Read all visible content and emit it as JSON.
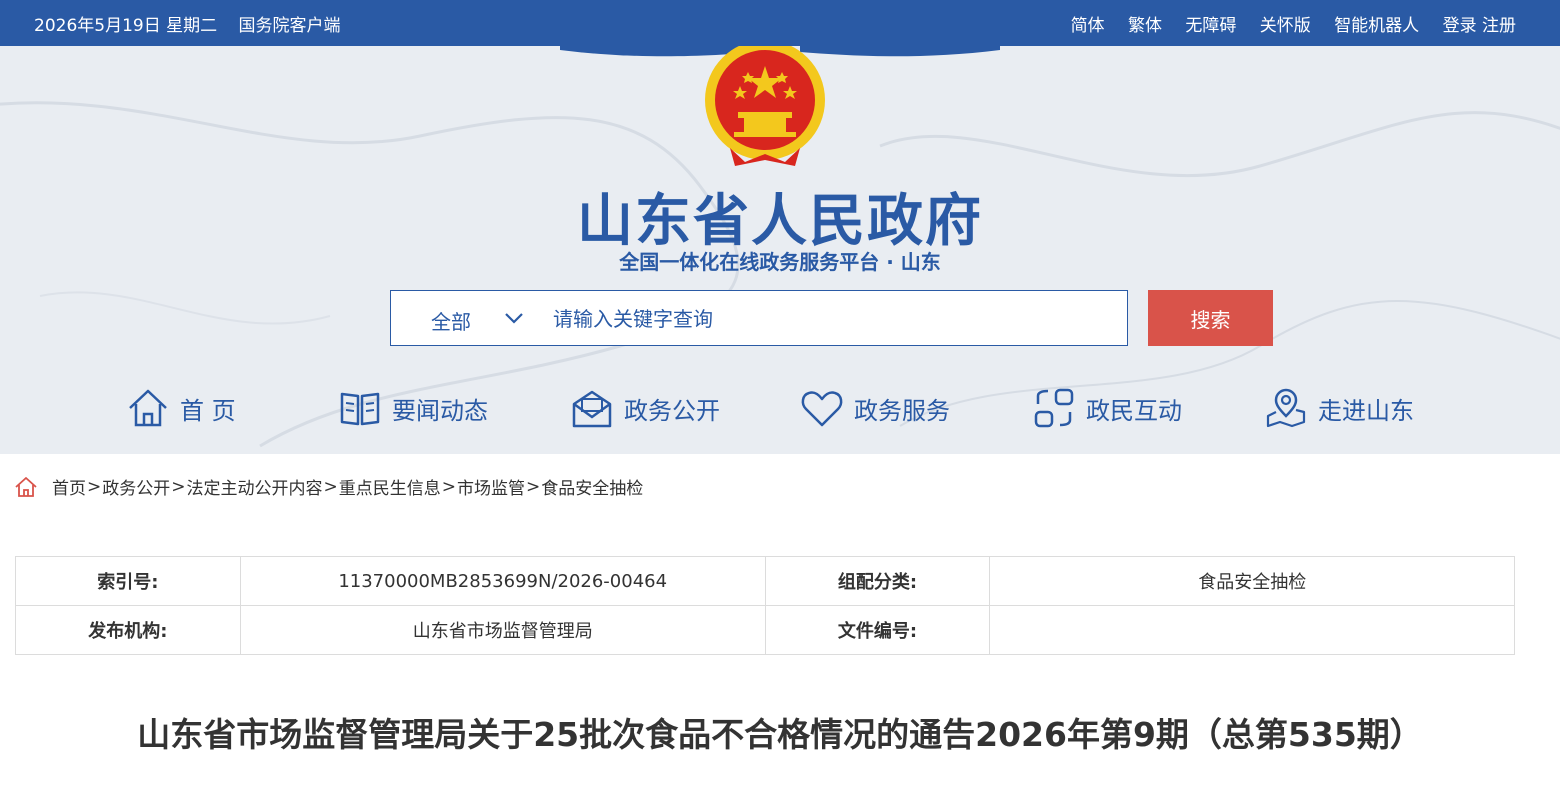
{
  "topbar": {
    "date": "2026年5月19日 星期二",
    "client": "国务院客户端",
    "links": [
      "简体",
      "繁体",
      "无障碍",
      "关怀版",
      "智能机器人",
      "登录 注册"
    ]
  },
  "header": {
    "title": "山东省人民政府",
    "subtitle": "全国一体化在线政务服务平台 · 山东"
  },
  "search": {
    "scope": "全部",
    "placeholder": "请输入关键字查询",
    "button": "搜索"
  },
  "nav": [
    {
      "label": "首 页",
      "icon": "home-icon"
    },
    {
      "label": "要闻动态",
      "icon": "book-icon"
    },
    {
      "label": "政务公开",
      "icon": "mail-icon"
    },
    {
      "label": "政务服务",
      "icon": "heart-icon"
    },
    {
      "label": "政民互动",
      "icon": "interaction-icon"
    },
    {
      "label": "走进山东",
      "icon": "location-icon"
    }
  ],
  "breadcrumb": [
    "首页",
    "政务公开",
    "法定主动公开内容",
    "重点民生信息",
    "市场监管",
    "食品安全抽检"
  ],
  "info": {
    "index_label": "索引号:",
    "index_value": "11370000MB2853699N/2026-00464",
    "category_label": "组配分类:",
    "category_value": "食品安全抽检",
    "publisher_label": "发布机构:",
    "publisher_value": "山东省市场监督管理局",
    "docnum_label": "文件编号:",
    "docnum_value": ""
  },
  "article": {
    "title": "山东省市场监督管理局关于25批次食品不合格情况的通告2026年第9期（总第535期）"
  },
  "colors": {
    "brand_blue": "#2a5aa5",
    "search_red": "#d9534a",
    "emblem_red": "#d8261e",
    "emblem_gold": "#f3c81d"
  }
}
